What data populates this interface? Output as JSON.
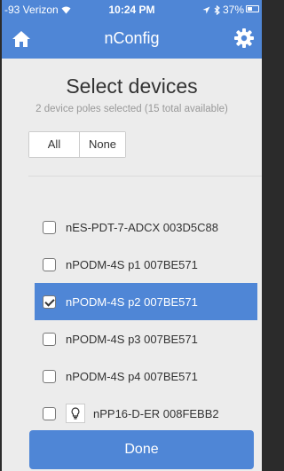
{
  "status_bar": {
    "carrier": "-93 Verizon",
    "time": "10:24 PM",
    "battery": "37%"
  },
  "nav": {
    "title": "nConfig",
    "left_icon": "home-icon",
    "right_icon": "gear-icon"
  },
  "heading": {
    "title": "Select devices",
    "subtitle": "2 device poles selected (15 total available)"
  },
  "selection_buttons": {
    "all_label": "All",
    "none_label": "None"
  },
  "devices": [
    {
      "label": "nES-PDT-7-ADCX 003D5C88",
      "checked": false,
      "icon": ""
    },
    {
      "label": "nPODM-4S p1 007BE571",
      "checked": false,
      "icon": ""
    },
    {
      "label": "nPODM-4S p2 007BE571",
      "checked": true,
      "icon": ""
    },
    {
      "label": "nPODM-4S p3 007BE571",
      "checked": false,
      "icon": ""
    },
    {
      "label": "nPODM-4S p4 007BE571",
      "checked": false,
      "icon": ""
    },
    {
      "label": "nPP16-D-ER 008FEBB2",
      "checked": false,
      "icon": "lightbulb-icon"
    }
  ],
  "done_label": "Done",
  "colors": {
    "accent": "#4f86d6",
    "background": "#ececec"
  }
}
